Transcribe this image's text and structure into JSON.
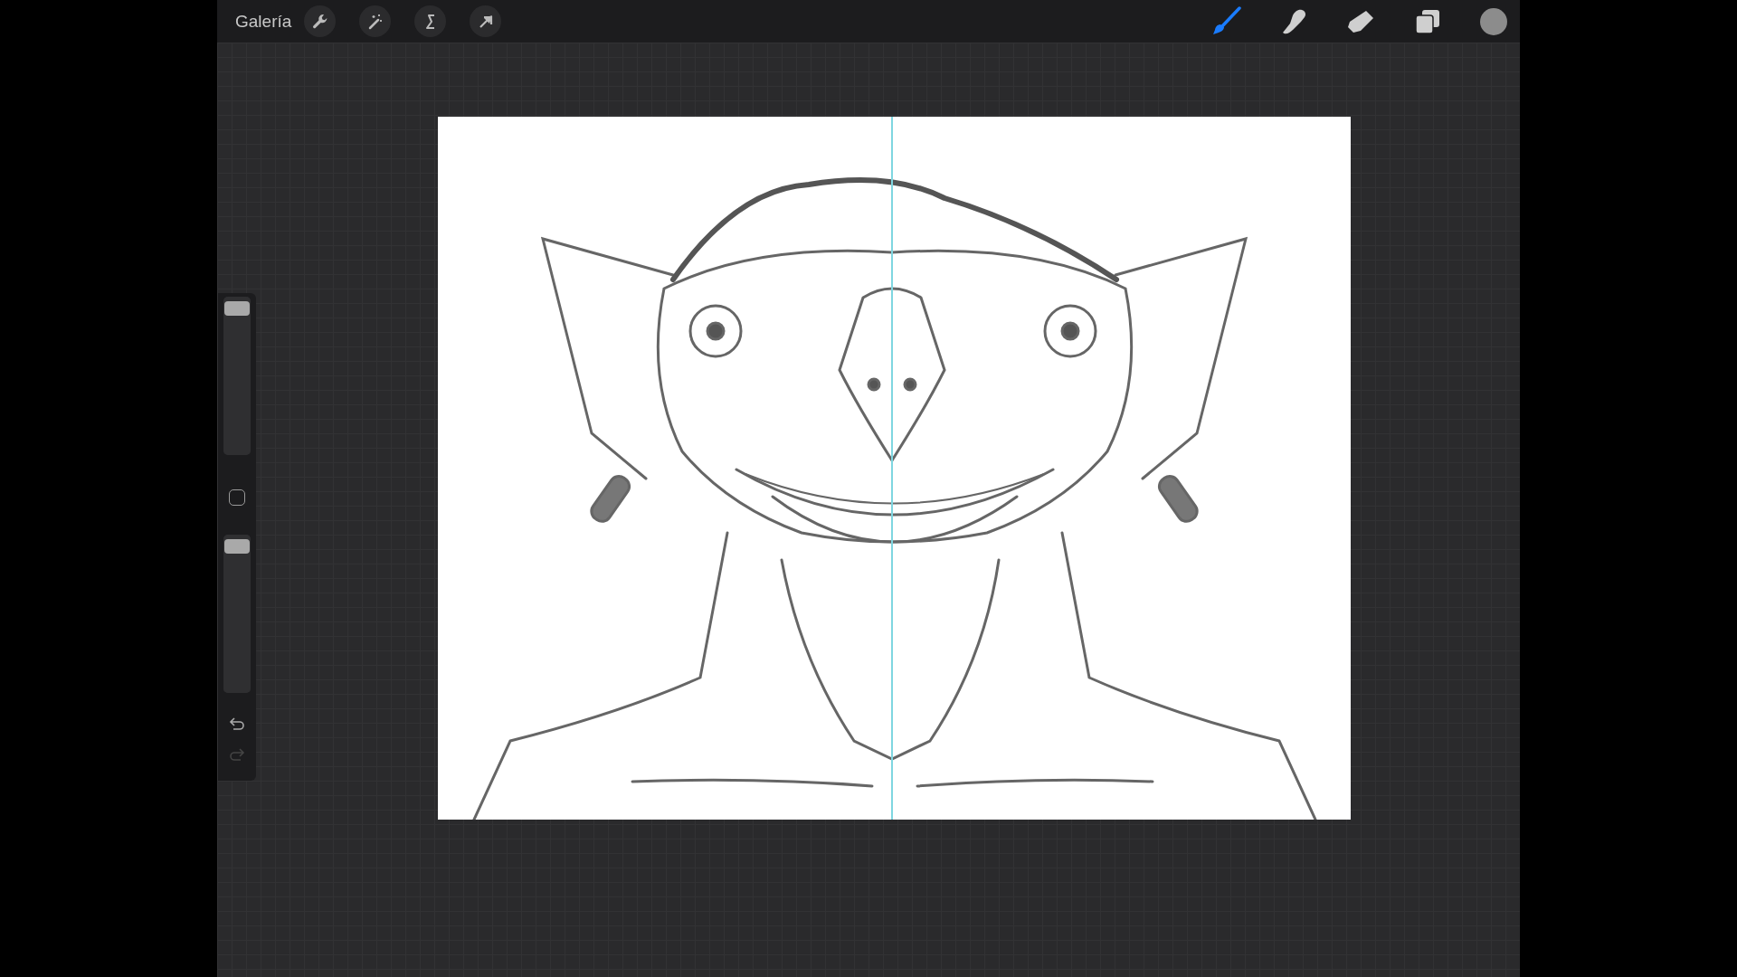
{
  "toolbar": {
    "gallery_label": "Galería",
    "actions": [
      {
        "kind": "wrench"
      },
      {
        "kind": "wand"
      },
      {
        "kind": "selection"
      },
      {
        "kind": "transform"
      }
    ],
    "tools": [
      {
        "kind": "brush",
        "selected": true
      },
      {
        "kind": "smudge",
        "selected": false
      },
      {
        "kind": "eraser",
        "selected": false
      },
      {
        "kind": "layers",
        "selected": false
      }
    ]
  },
  "sidebar": {
    "sliders": [
      {
        "level": 1
      },
      {
        "level": 1
      }
    ],
    "undo": {
      "disabled": false
    },
    "redo": {
      "disabled": true
    }
  },
  "canvas": {
    "symmetry_guide": true
  }
}
